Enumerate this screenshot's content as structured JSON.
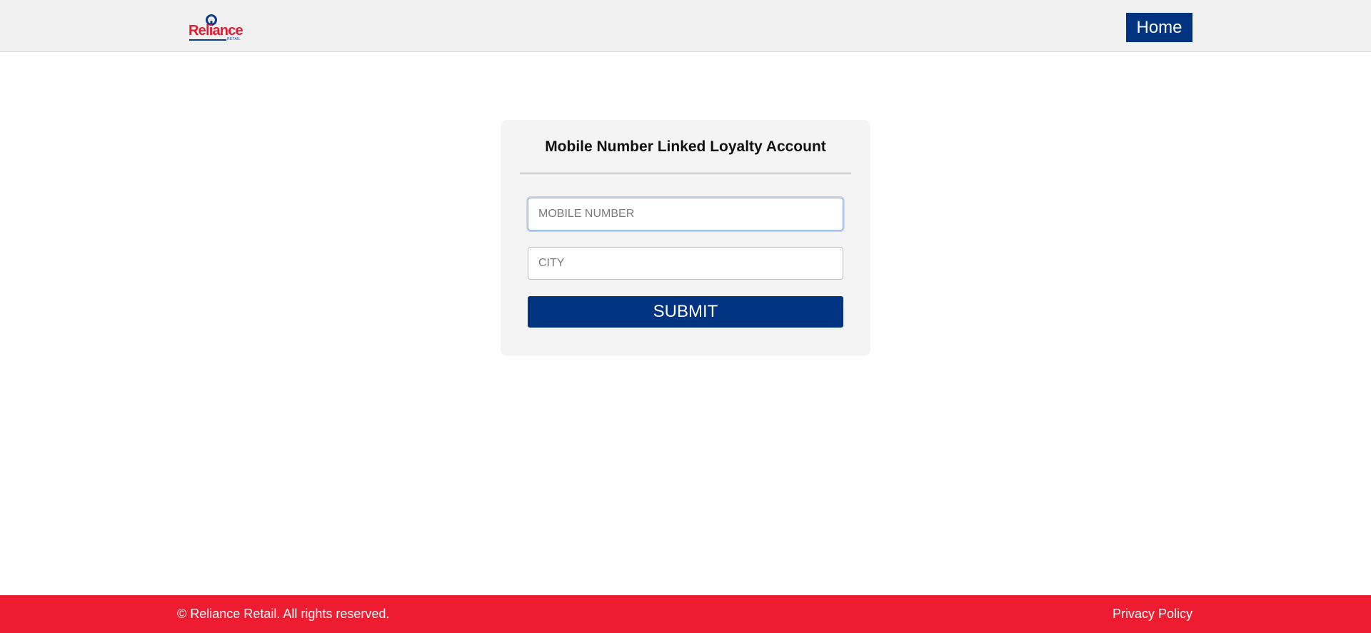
{
  "header": {
    "logo": {
      "wordmark": "Reliance",
      "sub": "RETAIL",
      "icon": "reliance-logo-mark"
    },
    "home_label": "Home"
  },
  "form": {
    "title": "Mobile Number Linked Loyalty Account",
    "mobile_placeholder": "MOBILE NUMBER",
    "mobile_value": "",
    "city_placeholder": "CITY",
    "city_value": "",
    "submit_label": "SUBMIT"
  },
  "footer": {
    "copyright": "© Reliance Retail. All rights reserved.",
    "privacy_label": "Privacy Policy"
  },
  "colors": {
    "primary_blue": "#003380",
    "footer_red": "#ee1c31",
    "logo_red": "#e31b2e",
    "header_bg": "#f0f0f1",
    "card_bg": "#f4f4f4"
  }
}
